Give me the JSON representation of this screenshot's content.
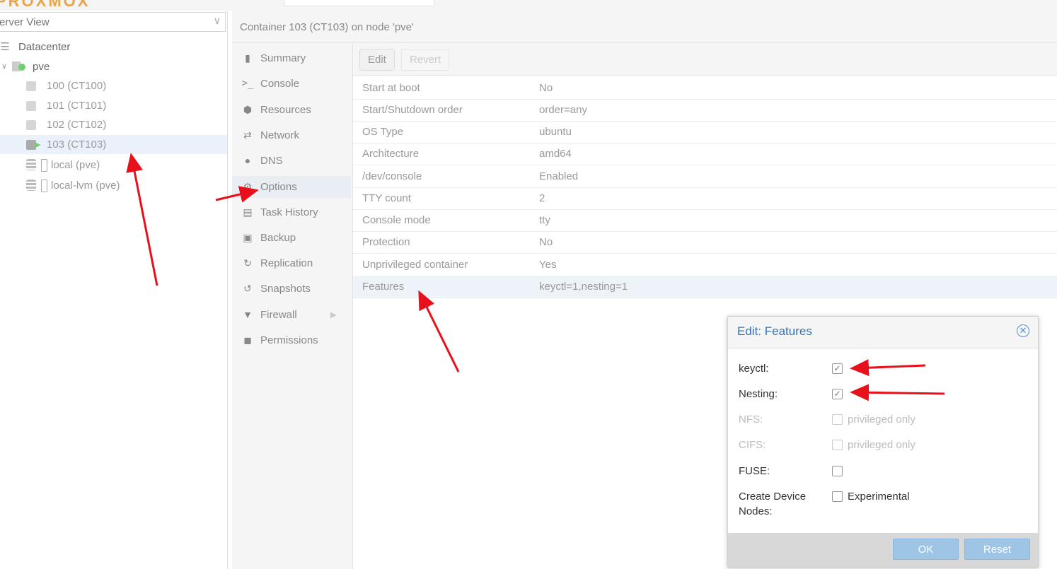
{
  "logo": {
    "text": "PROXMOX"
  },
  "tree": {
    "view_label": "erver View",
    "items": [
      {
        "label": "Datacenter"
      },
      {
        "label": "pve"
      },
      {
        "label": "100 (CT100)"
      },
      {
        "label": "101 (CT101)"
      },
      {
        "label": "102 (CT102)"
      },
      {
        "label": "103 (CT103)"
      },
      {
        "label": "local (pve)"
      },
      {
        "label": "local-lvm (pve)"
      }
    ]
  },
  "header": {
    "title": "Container 103 (CT103) on node 'pve'"
  },
  "nav": {
    "items": [
      {
        "label": "Summary",
        "icon": "book-icon"
      },
      {
        "label": "Console",
        "icon": "terminal-icon"
      },
      {
        "label": "Resources",
        "icon": "cube-icon"
      },
      {
        "label": "Network",
        "icon": "exchange-icon"
      },
      {
        "label": "DNS",
        "icon": "globe-icon"
      },
      {
        "label": "Options",
        "icon": "gear-icon"
      },
      {
        "label": "Task History",
        "icon": "list-icon"
      },
      {
        "label": "Backup",
        "icon": "floppy-icon"
      },
      {
        "label": "Replication",
        "icon": "retweet-icon"
      },
      {
        "label": "Snapshots",
        "icon": "history-icon"
      },
      {
        "label": "Firewall",
        "icon": "shield-icon"
      },
      {
        "label": "Permissions",
        "icon": "unlock-icon"
      }
    ]
  },
  "toolbar": {
    "edit_label": "Edit",
    "revert_label": "Revert"
  },
  "options": [
    {
      "key": "Start at boot",
      "value": "No"
    },
    {
      "key": "Start/Shutdown order",
      "value": "order=any"
    },
    {
      "key": "OS Type",
      "value": "ubuntu"
    },
    {
      "key": "Architecture",
      "value": "amd64"
    },
    {
      "key": "/dev/console",
      "value": "Enabled"
    },
    {
      "key": "TTY count",
      "value": "2"
    },
    {
      "key": "Console mode",
      "value": "tty"
    },
    {
      "key": "Protection",
      "value": "No"
    },
    {
      "key": "Unprivileged container",
      "value": "Yes"
    },
    {
      "key": "Features",
      "value": "keyctl=1,nesting=1"
    }
  ],
  "dialog": {
    "title": "Edit: Features",
    "fields": [
      {
        "label": "keyctl:",
        "checked": true,
        "note": ""
      },
      {
        "label": "Nesting:",
        "checked": true,
        "note": ""
      },
      {
        "label": "NFS:",
        "checked": false,
        "note": "privileged only"
      },
      {
        "label": "CIFS:",
        "checked": false,
        "note": "privileged only"
      },
      {
        "label": "FUSE:",
        "checked": false,
        "note": ""
      },
      {
        "label": "Create Device Nodes:",
        "checked": false,
        "note": "Experimental"
      }
    ],
    "ok_label": "OK",
    "reset_label": "Reset"
  },
  "colors": {
    "accent": "#3473b3",
    "annotation": "#e8101a",
    "selection": "#eaf1fa",
    "button": "#9ec5e6"
  }
}
